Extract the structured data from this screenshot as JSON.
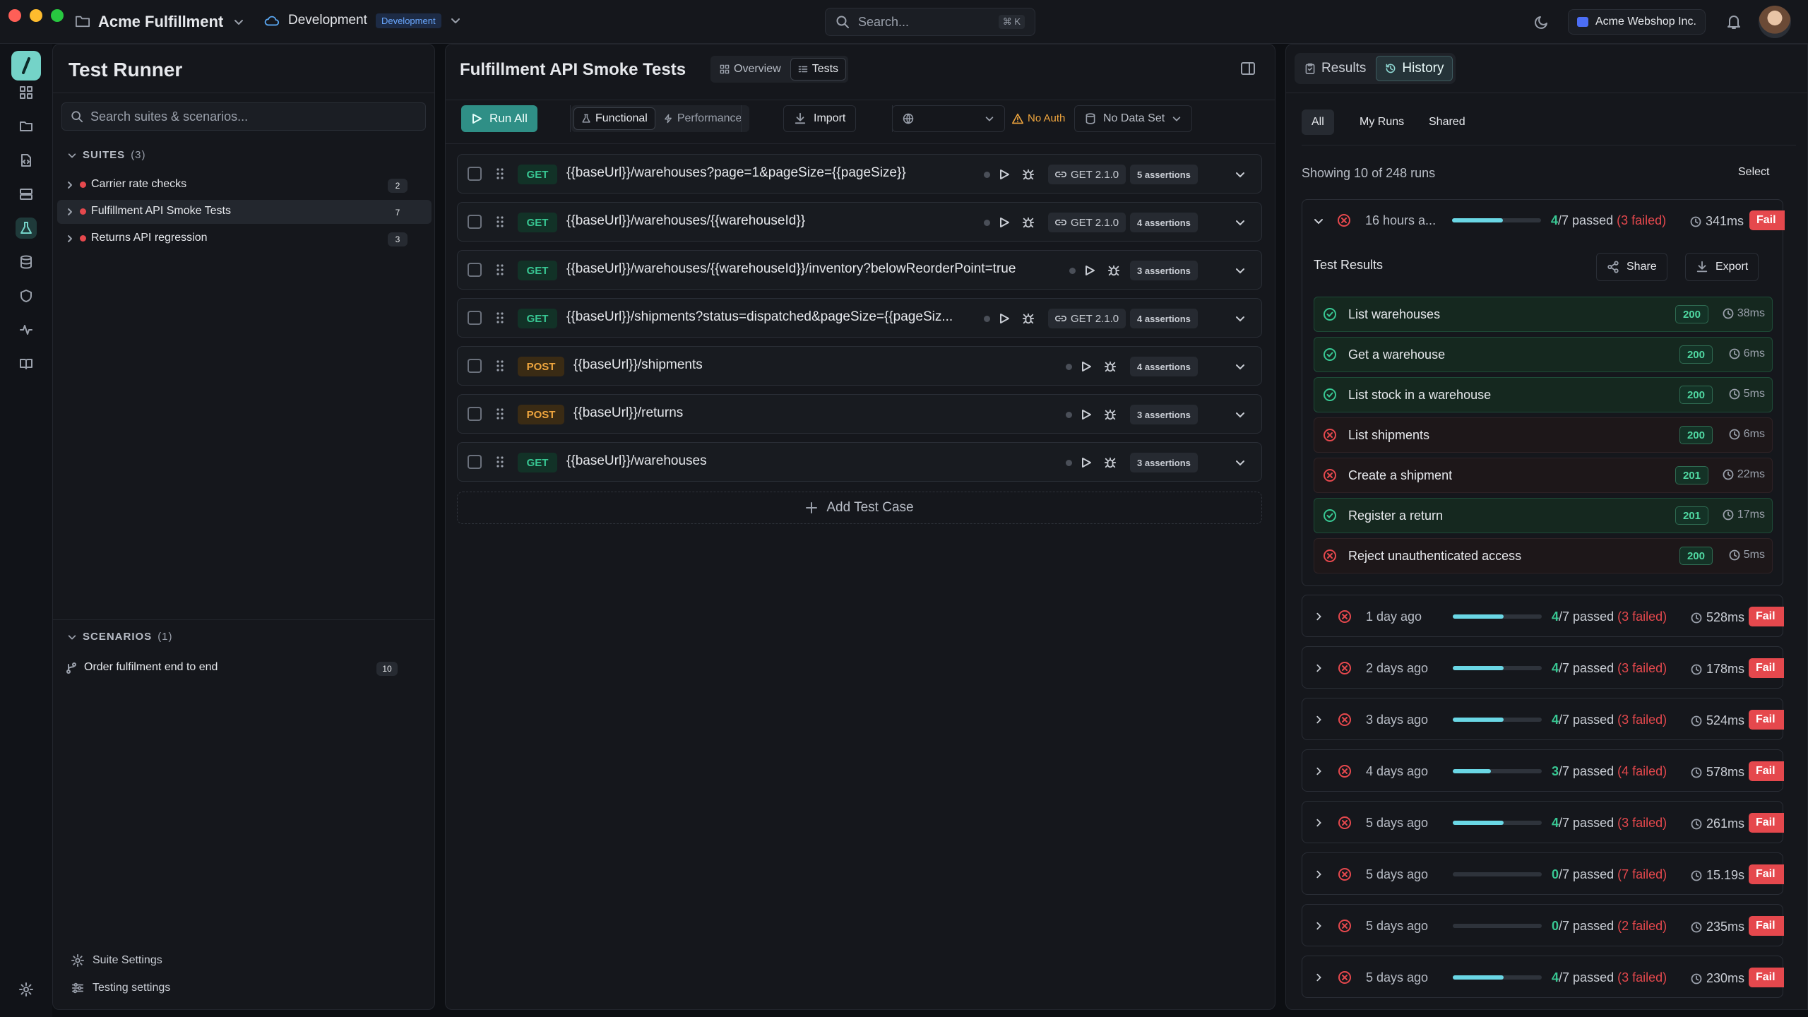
{
  "app": {
    "workspace": "Acme Fulfillment",
    "environment": "Development",
    "env_badge": "Development",
    "search_placeholder": "Search...",
    "shortcut": "⌘ K",
    "org": "Acme Webshop Inc."
  },
  "sidebar": {
    "title": "Test Runner",
    "search_placeholder": "Search suites & scenarios...",
    "suites_label": "SUITES",
    "suites_count": "(3)",
    "suites": [
      {
        "name": "Carrier rate checks",
        "count": "2"
      },
      {
        "name": "Fulfillment API Smoke Tests",
        "count": "7"
      },
      {
        "name": "Returns API regression",
        "count": "3"
      }
    ],
    "scenarios_label": "SCENARIOS",
    "scenarios_count": "(1)",
    "scenarios": [
      {
        "name": "Order fulfilment end to end",
        "count": "10"
      }
    ],
    "footer": {
      "suite_settings": "Suite Settings",
      "testing_settings": "Testing settings"
    }
  },
  "main": {
    "title": "Fulfillment API Smoke Tests",
    "tabs": [
      "Overview",
      "Tests"
    ],
    "toolbar": {
      "run_all": "Run All",
      "functional": "Functional",
      "performance": "Performance",
      "import": "Import",
      "no_auth": "No Auth",
      "no_data_set": "No Data Set"
    },
    "tests": [
      {
        "method": "GET",
        "url": "{{baseUrl}}/warehouses?page=1&pageSize={{pageSize}}",
        "version": "GET 2.1.0",
        "assertions": "5 assertions"
      },
      {
        "method": "GET",
        "url": "{{baseUrl}}/warehouses/{{warehouseId}}",
        "version": "GET 2.1.0",
        "assertions": "4 assertions"
      },
      {
        "method": "GET",
        "url": "{{baseUrl}}/warehouses/{{warehouseId}}/inventory?belowReorderPoint=true",
        "version": "",
        "assertions": "3 assertions"
      },
      {
        "method": "GET",
        "url": "{{baseUrl}}/shipments?status=dispatched&pageSize={{pageSiz...",
        "version": "GET 2.1.0",
        "assertions": "4 assertions"
      },
      {
        "method": "POST",
        "url": "{{baseUrl}}/shipments",
        "version": "",
        "assertions": "4 assertions"
      },
      {
        "method": "POST",
        "url": "{{baseUrl}}/returns",
        "version": "",
        "assertions": "3 assertions"
      },
      {
        "method": "GET",
        "url": "{{baseUrl}}/warehouses",
        "version": "",
        "assertions": "3 assertions"
      }
    ],
    "add_test": "Add Test Case"
  },
  "right": {
    "tabs": [
      "Results",
      "History"
    ],
    "filters": [
      "All",
      "My Runs",
      "Shared"
    ],
    "showing": "Showing 10 of 248 runs",
    "select": "Select",
    "test_results_label": "Test Results",
    "share": "Share",
    "export": "Export",
    "fail_label": "Fail",
    "runs": [
      {
        "when": "16 hours a...",
        "passed": "4",
        "total": "/7",
        "passed_word": "passed",
        "failed": "(3 failed)",
        "time": "341ms",
        "progress": 0.57
      },
      {
        "when": "1 day ago",
        "passed": "4",
        "total": "/7",
        "passed_word": "passed",
        "failed": "(3 failed)",
        "time": "528ms",
        "progress": 0.57
      },
      {
        "when": "2 days ago",
        "passed": "4",
        "total": "/7",
        "passed_word": "passed",
        "failed": "(3 failed)",
        "time": "178ms",
        "progress": 0.57
      },
      {
        "when": "3 days ago",
        "passed": "4",
        "total": "/7",
        "passed_word": "passed",
        "failed": "(3 failed)",
        "time": "524ms",
        "progress": 0.57
      },
      {
        "when": "4 days ago",
        "passed": "3",
        "total": "/7",
        "passed_word": "passed",
        "failed": "(4 failed)",
        "time": "578ms",
        "progress": 0.43
      },
      {
        "when": "5 days ago",
        "passed": "4",
        "total": "/7",
        "passed_word": "passed",
        "failed": "(3 failed)",
        "time": "261ms",
        "progress": 0.57
      },
      {
        "when": "5 days ago",
        "passed": "0",
        "total": "/7",
        "passed_word": "passed",
        "failed": "(7 failed)",
        "time": "15.19s",
        "progress": 0
      },
      {
        "when": "5 days ago",
        "passed": "0",
        "total": "/7",
        "passed_word": "passed",
        "failed": "(2 failed)",
        "time": "235ms",
        "progress": 0
      },
      {
        "when": "5 days ago",
        "passed": "4",
        "total": "/7",
        "passed_word": "passed",
        "failed": "(3 failed)",
        "time": "230ms",
        "progress": 0.57
      }
    ],
    "results": [
      {
        "name": "List warehouses",
        "status": "pass",
        "code": "200",
        "time": "38ms"
      },
      {
        "name": "Get a warehouse",
        "status": "pass",
        "code": "200",
        "time": "6ms"
      },
      {
        "name": "List stock in a warehouse",
        "status": "pass",
        "code": "200",
        "time": "5ms"
      },
      {
        "name": "List shipments",
        "status": "fail",
        "code": "200",
        "time": "6ms"
      },
      {
        "name": "Create a shipment",
        "status": "fail",
        "code": "201",
        "time": "22ms"
      },
      {
        "name": "Register a return",
        "status": "pass",
        "code": "201",
        "time": "17ms"
      },
      {
        "name": "Reject unauthenticated access",
        "status": "fail",
        "code": "200",
        "time": "5ms"
      }
    ]
  },
  "colors": {
    "accent": "#6ad7e5",
    "pass": "#38c793",
    "fail": "#e5484d",
    "warn": "#f0a63e"
  }
}
